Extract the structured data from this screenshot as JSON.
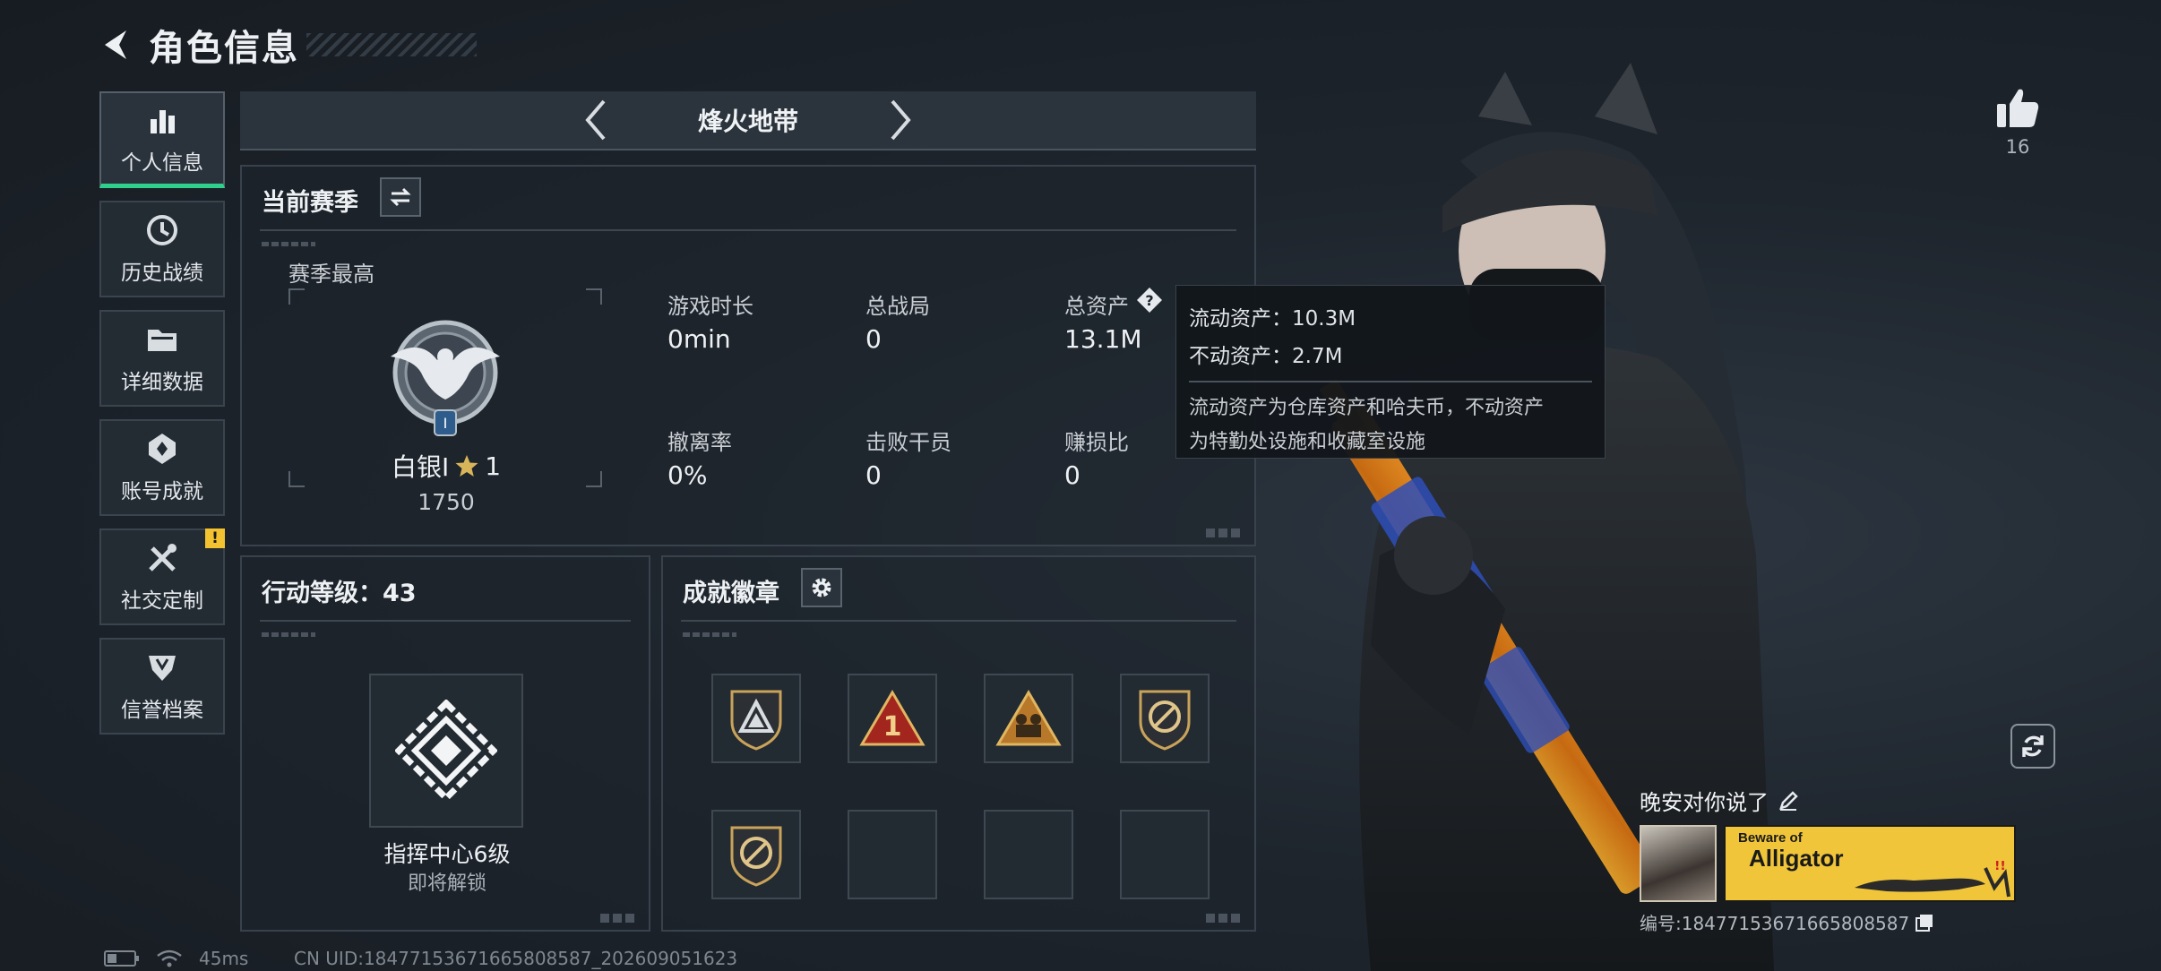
{
  "header": {
    "title": "角色信息",
    "back_icon": "back-arrow-icon"
  },
  "nav": {
    "items": [
      {
        "label": "个人信息",
        "icon": "bar-chart-icon",
        "active": true
      },
      {
        "label": "历史战绩",
        "icon": "history-clock-icon"
      },
      {
        "label": "详细数据",
        "icon": "folder-icon"
      },
      {
        "label": "账号成就",
        "icon": "achievement-badge-icon"
      },
      {
        "label": "社交定制",
        "icon": "tools-icon",
        "badge": "!"
      },
      {
        "label": "信誉档案",
        "icon": "reputation-shield-icon"
      }
    ],
    "active_color": "#2fd08c"
  },
  "mode": {
    "title": "烽火地带"
  },
  "season": {
    "title": "当前赛季",
    "best_label": "赛季最高",
    "rank_name": "白银I",
    "rank_stars": "1",
    "rank_points": "1750",
    "stats": [
      {
        "label": "游戏时长",
        "value": "0min"
      },
      {
        "label": "总战局",
        "value": "0"
      },
      {
        "label": "总资产",
        "value": "13.1M"
      },
      {
        "label": "撤离率",
        "value": "0%"
      },
      {
        "label": "击败干员",
        "value": "0"
      },
      {
        "label": "赚损比",
        "value": "0"
      }
    ]
  },
  "tooltip": {
    "liquid": "流动资产：10.3M",
    "fixed": "不动资产：2.7M",
    "desc_line1": "流动资产为仓库资产和哈夫币，不动资产",
    "desc_line2": "为特勤处设施和收藏室设施"
  },
  "action_level": {
    "title": "行动等级：43",
    "facility_name": "指挥中心6级",
    "facility_status": "即将解锁"
  },
  "badges": {
    "title": "成就徽章",
    "slots": [
      "pyramid-badge",
      "rank-one-badge",
      "squad-badge",
      "blocked-gun-badge",
      "blocked-gun-badge",
      "empty",
      "empty",
      "empty"
    ]
  },
  "social": {
    "like_count": "16",
    "player_name": "晚安对你说了",
    "banner_line1": "Beware of",
    "banner_line2": "Alligator",
    "player_id": "编号:1847715367166580858​7"
  },
  "status": {
    "ping": "45ms",
    "uid": "CN UID:18477153671665808587_202609051623"
  },
  "colors": {
    "accent": "#2fd08c",
    "warning": "#f2c230",
    "banner": "#f0c53a"
  }
}
